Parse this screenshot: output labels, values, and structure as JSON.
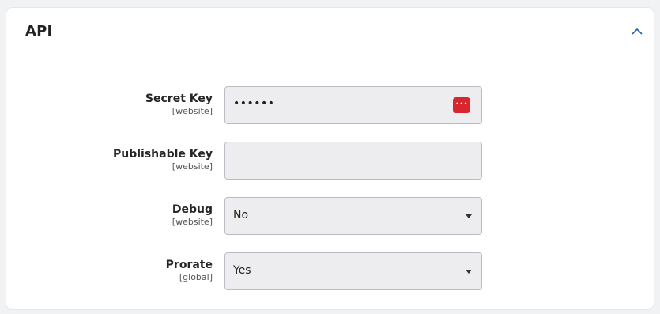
{
  "section": {
    "title": "API",
    "toggle_icon": "chevron-up-icon"
  },
  "fields": {
    "secret_key": {
      "label": "Secret Key",
      "scope": "[website]",
      "value": "••••••",
      "icon": "password-manager-icon"
    },
    "publishable_key": {
      "label": "Publishable Key",
      "scope": "[website]",
      "value": ""
    },
    "debug": {
      "label": "Debug",
      "scope": "[website]",
      "value": "No"
    },
    "prorate": {
      "label": "Prorate",
      "scope": "[global]",
      "value": "Yes"
    }
  },
  "colors": {
    "accent": "#1f5fb0",
    "password_manager": "#d7262d"
  }
}
